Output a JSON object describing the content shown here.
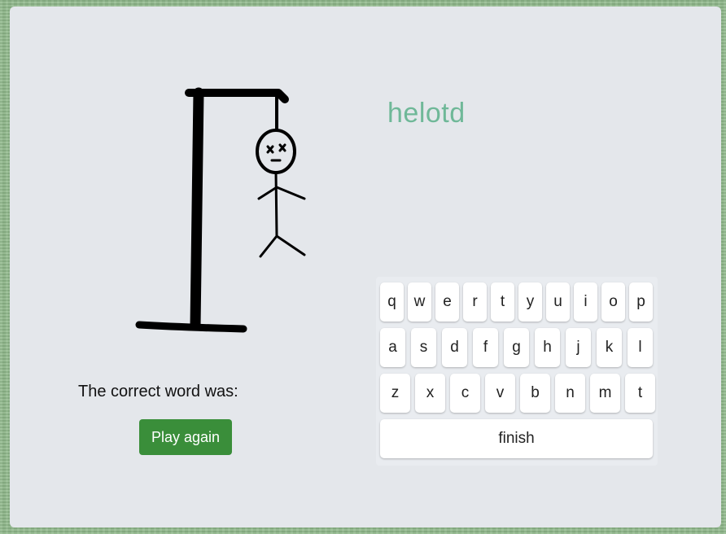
{
  "game": {
    "word": "helotd",
    "correct_word_label": "The correct word was:",
    "play_again_label": "Play again"
  },
  "keyboard": {
    "row1": [
      "q",
      "w",
      "e",
      "r",
      "t",
      "y",
      "u",
      "i",
      "o",
      "p"
    ],
    "row2": [
      "a",
      "s",
      "d",
      "f",
      "g",
      "h",
      "j",
      "k",
      "l"
    ],
    "row3": [
      "z",
      "x",
      "c",
      "v",
      "b",
      "n",
      "m",
      "t"
    ],
    "finish_label": "finish"
  },
  "colors": {
    "word": "#6fb898",
    "play_button": "#3a8e3a",
    "card": "#e4e7eb"
  }
}
